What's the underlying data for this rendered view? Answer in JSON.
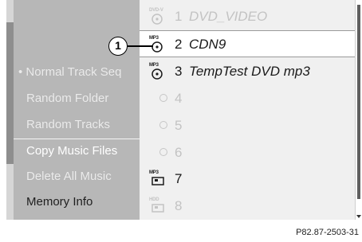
{
  "menu": {
    "items": [
      {
        "label": "• Normal Track Seq",
        "state": "disabled"
      },
      {
        "label": "Random Folder",
        "state": "disabled"
      },
      {
        "label": "Random Tracks",
        "state": "disabled"
      },
      {
        "label": "Copy Music Files",
        "state": "active"
      },
      {
        "label": "Delete All Music",
        "state": "disabled"
      },
      {
        "label": "Memory Info",
        "state": "normal"
      }
    ]
  },
  "tracks": [
    {
      "number": "1",
      "title": "DVD_VIDEO",
      "icon_caption": "DVD-V",
      "icon": "disc-icon",
      "style": "dim"
    },
    {
      "number": "2",
      "title": "CDN9",
      "icon_caption": "MP3",
      "icon": "disc-icon",
      "style": "dark",
      "selected": true
    },
    {
      "number": "3",
      "title": "TempTest DVD mp3",
      "icon_caption": "MP3",
      "icon": "disc-icon",
      "style": "dark"
    },
    {
      "number": "4",
      "title": "",
      "icon": "empty-slot-icon",
      "style": "dim"
    },
    {
      "number": "5",
      "title": "",
      "icon": "empty-slot-icon",
      "style": "dim"
    },
    {
      "number": "6",
      "title": "",
      "icon": "empty-slot-icon",
      "style": "dim"
    },
    {
      "number": "7",
      "title": "",
      "icon_caption": "MP3",
      "icon": "memory-card-icon",
      "style": "dark"
    },
    {
      "number": "8",
      "title": "",
      "icon_caption": "HDD",
      "icon": "memory-card-icon",
      "style": "dim"
    }
  ],
  "callout": {
    "label": "1"
  },
  "caption": "P82.87-2503-31",
  "colors": {
    "background": "#b7b7b7",
    "list": "#f0f0f0",
    "selected": "#ffffff",
    "active_text": "#ffffff"
  }
}
